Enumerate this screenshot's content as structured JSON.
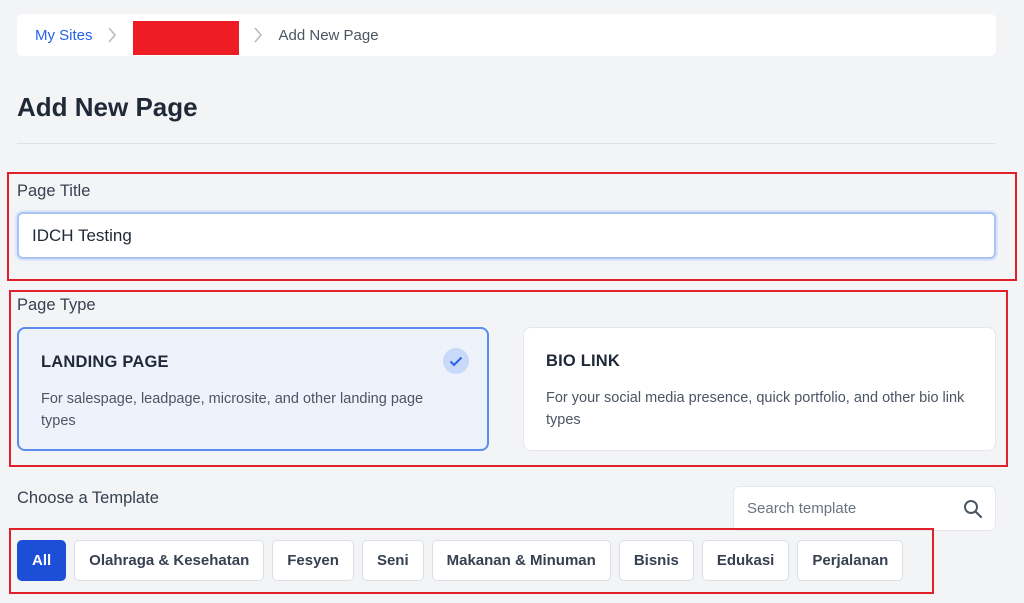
{
  "breadcrumb": {
    "items": [
      "My Sites",
      "Add New Page"
    ]
  },
  "page": {
    "title": "Add New Page"
  },
  "form": {
    "page_title_label": "Page Title",
    "page_title_value": "IDCH Testing",
    "page_type_label": "Page Type",
    "page_types": [
      {
        "title": "LANDING PAGE",
        "description": "For salespage, leadpage, microsite, and other landing page types",
        "selected": true
      },
      {
        "title": "BIO LINK",
        "description": "For your social media presence, quick portfolio, and other bio link types",
        "selected": false
      }
    ]
  },
  "templates": {
    "label": "Choose a Template",
    "search_placeholder": "Search template",
    "categories": [
      "All",
      "Olahraga & Kesehatan",
      "Fesyen",
      "Seni",
      "Makanan & Minuman",
      "Bisnis",
      "Edukasi",
      "Perjalanan"
    ],
    "active_category": "All"
  },
  "colors": {
    "accent": "#1d4ed8",
    "highlight": "#e0202a",
    "redacted": "#ee1c25"
  },
  "icons": {
    "breadcrumb_separator": "chevron-right-icon",
    "selected": "check-icon",
    "search": "search-icon"
  }
}
